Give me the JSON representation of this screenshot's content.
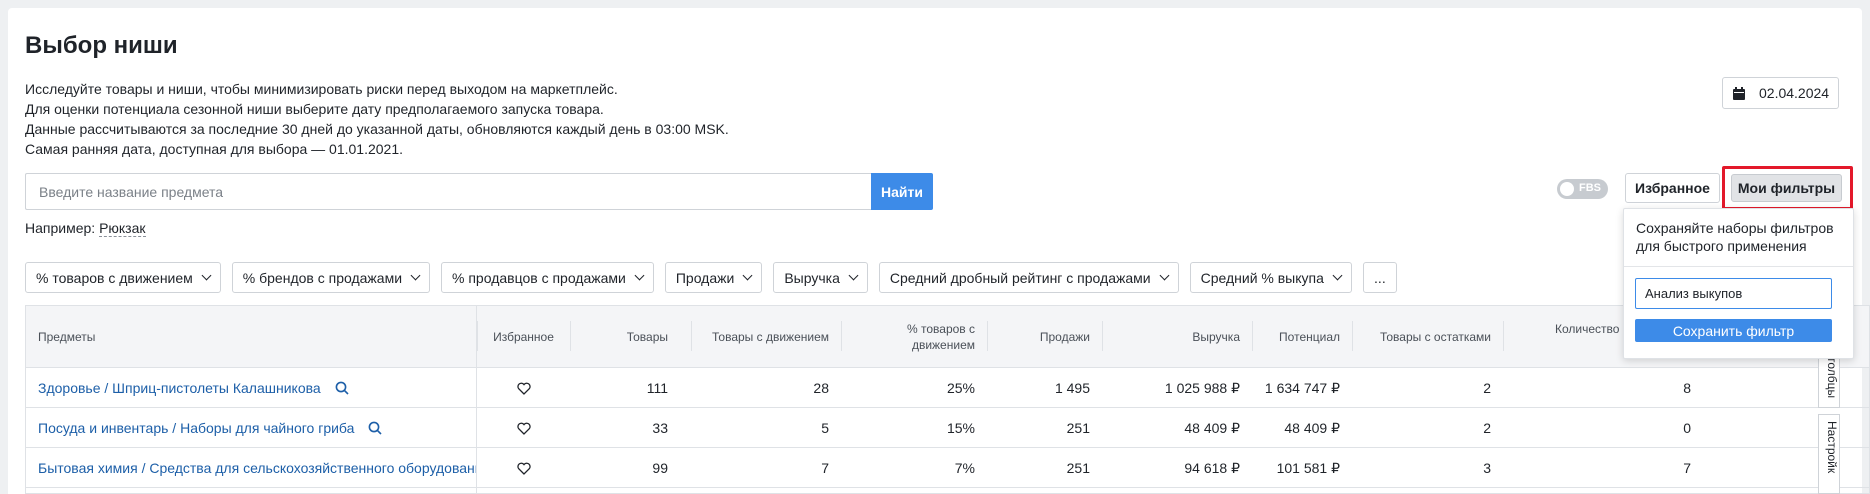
{
  "page": {
    "title": "Выбор ниши",
    "description": [
      "Исследуйте товары и ниши, чтобы минимизировать риски перед выходом на маркетплейс.",
      "Для оценки потенциала сезонной ниши выберите дату предполагаемого запуска товара.",
      "Данные рассчитываются за последние 30 дней до указанной даты, обновляются каждый день в 03:00 MSK.",
      "Самая ранняя дата, доступная для выбора — 01.01.2021."
    ],
    "date": "02.04.2024"
  },
  "search": {
    "placeholder": "Введите название предмета",
    "button": "Найти",
    "example_prefix": "Например: ",
    "example_value": "Рюкзак"
  },
  "toolbar": {
    "fbs_label": "FBS",
    "favorites_button": "Избранное",
    "my_filters_button": "Мои фильтры"
  },
  "filters": [
    "% товаров с движением",
    "% брендов с продажами",
    "% продавцов с продажами",
    "Продажи",
    "Выручка",
    "Средний дробный рейтинг с продажами",
    "Средний % выкупа"
  ],
  "filters_more": "...",
  "popup": {
    "text": "Сохраняйте наборы фильтров для быстрого применения",
    "input_value": "Анализ выкупов",
    "save_button": "Сохранить фильтр"
  },
  "table": {
    "headers": {
      "subject": "Предметы",
      "favorite": "Избранное",
      "products": "Товары",
      "products_moving": "Товары с движением",
      "pct_moving": "% товаров с движением",
      "sales": "Продажи",
      "revenue": "Выручка",
      "potential": "Потенциал",
      "with_stock": "Товары с остатками",
      "quantity": "Количество"
    },
    "rows": [
      {
        "subject": "Здоровье / Шприц-пистолеты Калашникова",
        "products": "111",
        "products_moving": "28",
        "pct_moving": "25%",
        "sales": "1 495",
        "revenue": "1 025 988 ₽",
        "potential": "1 634 747 ₽",
        "with_stock": "2",
        "quantity": "8"
      },
      {
        "subject": "Посуда и инвентарь / Наборы для чайного гриба",
        "products": "33",
        "products_moving": "5",
        "pct_moving": "15%",
        "sales": "251",
        "revenue": "48 409 ₽",
        "potential": "48 409 ₽",
        "with_stock": "2",
        "quantity": "0"
      },
      {
        "subject": "Бытовая химия / Средства для сельскохозяйственного оборудования",
        "products": "99",
        "products_moving": "7",
        "pct_moving": "7%",
        "sales": "251",
        "revenue": "94 618 ₽",
        "potential": "101 581 ₽",
        "with_stock": "3",
        "quantity": "7"
      }
    ]
  },
  "side_tabs": {
    "columns": "толбцы",
    "settings": "Настройк"
  },
  "colors": {
    "accent": "#3d8be8",
    "link": "#1d5fa8",
    "highlight_border": "#e3182a"
  }
}
